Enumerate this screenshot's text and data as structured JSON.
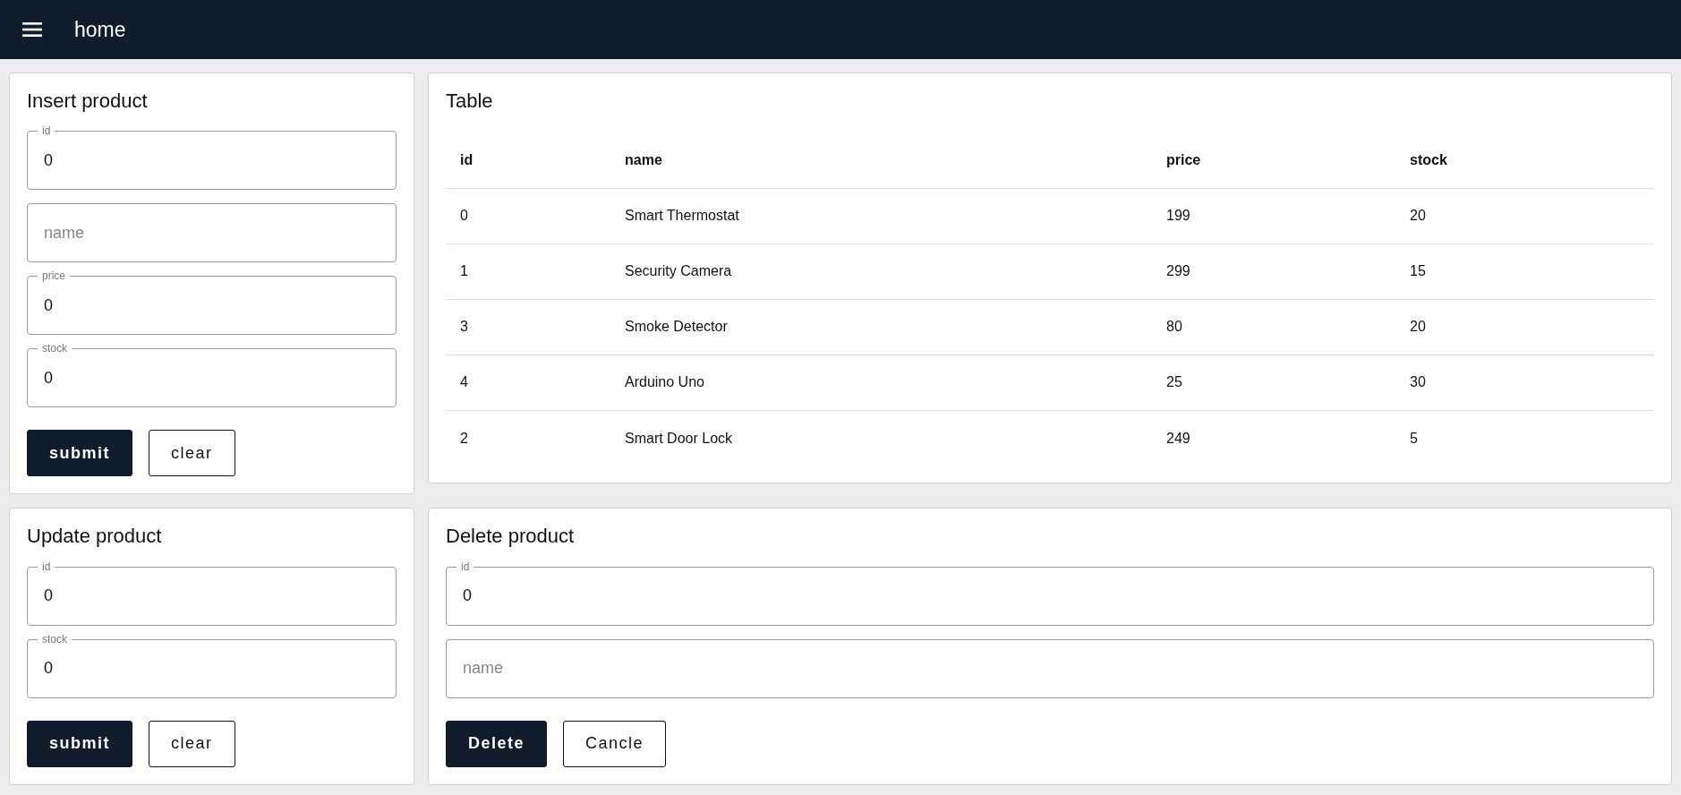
{
  "app_bar": {
    "title": "home"
  },
  "insert_form": {
    "title": "Insert product",
    "fields": [
      {
        "label": "id",
        "value": "0"
      },
      {
        "placeholder": "name"
      },
      {
        "label": "price",
        "value": "0"
      },
      {
        "label": "stock",
        "value": "0"
      }
    ],
    "buttons": [
      {
        "label": "submit",
        "kind": "primary"
      },
      {
        "label": "clear",
        "kind": "outline"
      }
    ]
  },
  "table": {
    "title": "Table",
    "columns": [
      "id",
      "name",
      "price",
      "stock"
    ],
    "rows": [
      [
        "0",
        "Smart Thermostat",
        "199",
        "20"
      ],
      [
        "1",
        "Security Camera",
        "299",
        "15"
      ],
      [
        "3",
        "Smoke Detector",
        "80",
        "20"
      ],
      [
        "4",
        "Arduino Uno",
        "25",
        "30"
      ],
      [
        "2",
        "Smart Door Lock",
        "249",
        "5"
      ]
    ]
  },
  "update_form": {
    "title": "Update product",
    "fields": [
      {
        "label": "id",
        "value": "0"
      },
      {
        "label": "stock",
        "value": "0"
      }
    ],
    "buttons": [
      {
        "label": "submit",
        "kind": "primary"
      },
      {
        "label": "clear",
        "kind": "outline"
      }
    ]
  },
  "delete_form": {
    "title": "Delete product",
    "fields": [
      {
        "label": "id",
        "value": "0"
      },
      {
        "placeholder": "name"
      }
    ],
    "buttons": [
      {
        "label": "Delete",
        "kind": "primary"
      },
      {
        "label": "Cancle",
        "kind": "outline"
      }
    ]
  }
}
